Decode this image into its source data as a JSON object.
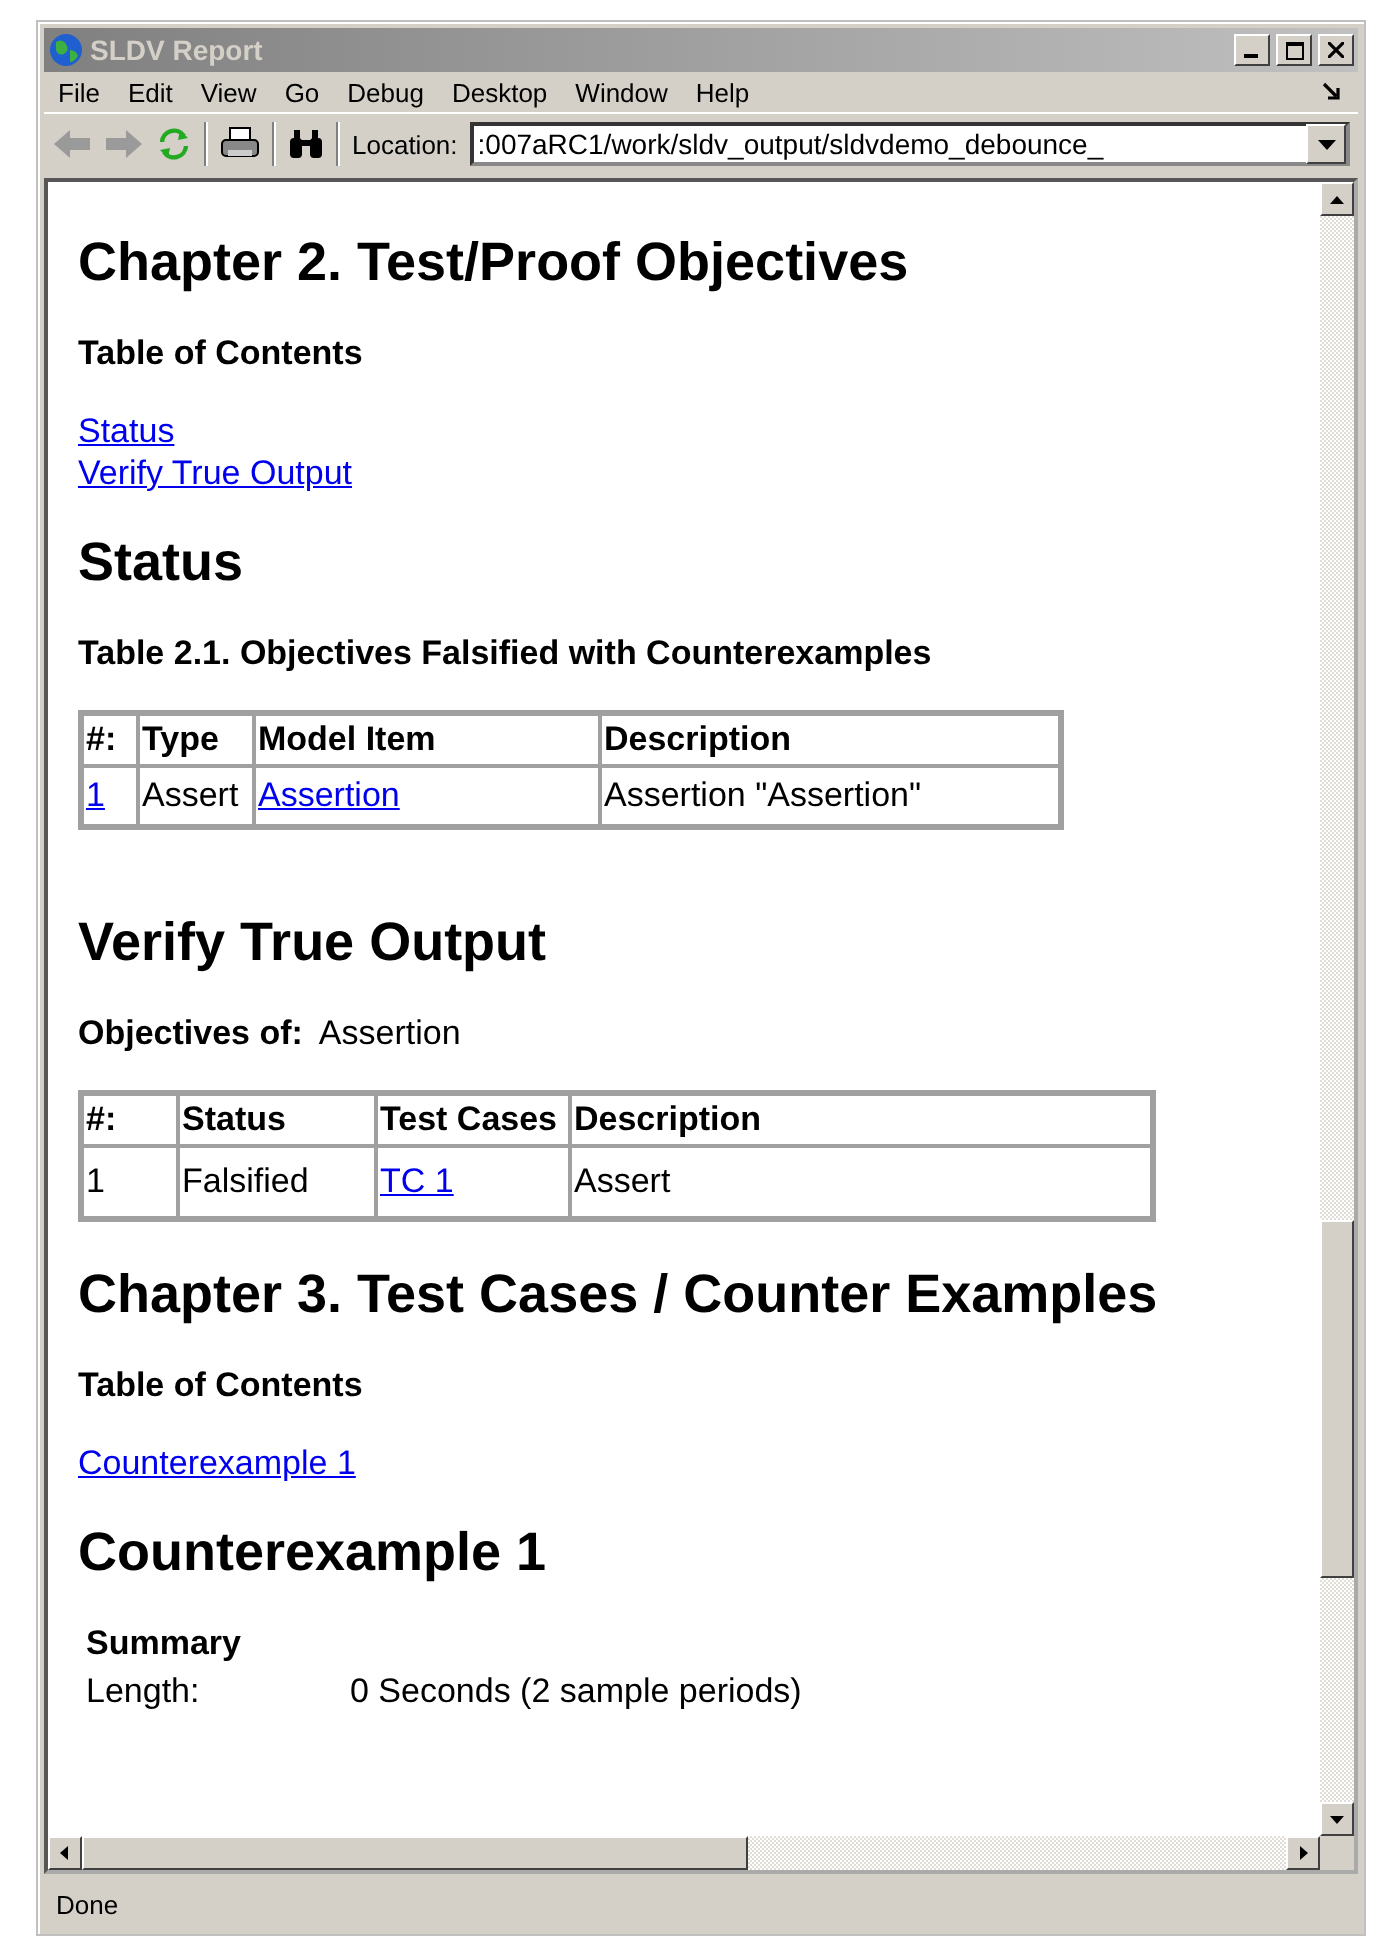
{
  "window": {
    "title": "SLDV Report"
  },
  "menu": [
    "File",
    "Edit",
    "View",
    "Go",
    "Debug",
    "Desktop",
    "Window",
    "Help"
  ],
  "toolbar": {
    "location_label": "Location:",
    "location_value": ":007aRC1/work/sldv_output/sldvdemo_debounce_"
  },
  "report": {
    "chapter2": {
      "title": "Chapter 2. Test/Proof Objectives",
      "toc_title": "Table of Contents",
      "toc": [
        "Status",
        "Verify True Output"
      ]
    },
    "status": {
      "heading": "Status",
      "caption": "Table 2.1. Objectives Falsified with Counterexamples",
      "columns": [
        "#:",
        "Type",
        "Model Item",
        "Description"
      ],
      "rows": [
        [
          {
            "text": "1",
            "link": true
          },
          {
            "text": "Assert",
            "link": false
          },
          {
            "text": "Assertion",
            "link": true
          },
          {
            "text": "Assertion \"Assertion\"",
            "link": false
          }
        ]
      ]
    },
    "verify": {
      "heading": "Verify True Output",
      "objectives_label": "Objectives of:",
      "objectives_value": "Assertion",
      "columns": [
        "#:",
        "Status",
        "Test Cases",
        "Description"
      ],
      "rows": [
        [
          {
            "text": "1",
            "link": false
          },
          {
            "text": "Falsified",
            "link": false
          },
          {
            "text": "TC 1",
            "link": true
          },
          {
            "text": "Assert",
            "link": false
          }
        ]
      ]
    },
    "chapter3": {
      "title": "Chapter 3. Test Cases / Counter Examples",
      "toc_title": "Table of Contents",
      "toc": [
        "Counterexample 1"
      ]
    },
    "counterexample": {
      "heading": "Counterexample 1",
      "summary_title": "Summary",
      "fields": [
        {
          "label": "Length:",
          "value": "0 Seconds (2 sample periods)"
        }
      ]
    }
  },
  "status_bar": "Done"
}
